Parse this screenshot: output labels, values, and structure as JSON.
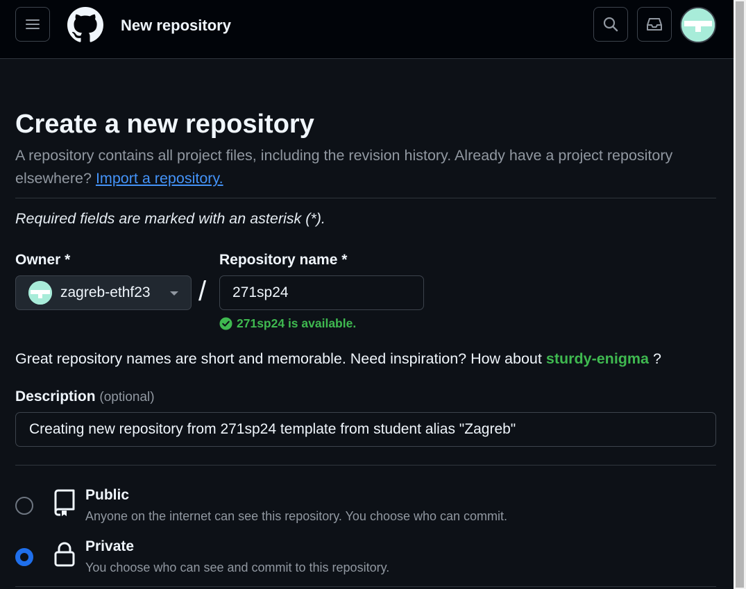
{
  "header": {
    "title": "New repository",
    "icons": {
      "menu": "hamburger-menu-icon",
      "logo": "github-logo-icon",
      "search": "search-icon",
      "inbox": "inbox-icon",
      "avatar": "user-avatar"
    }
  },
  "page": {
    "title": "Create a new repository",
    "intro_text": "A repository contains all project files, including the revision history. Already have a project repository elsewhere?",
    "import_link": "Import a repository.",
    "required_note": "Required fields are marked with an asterisk (*)."
  },
  "owner": {
    "label": "Owner *",
    "value": "zagreb-ethf23"
  },
  "repo_name": {
    "label": "Repository name *",
    "value": "271sp24",
    "availability": "271sp24 is available."
  },
  "suggestion": {
    "text": "Great repository names are short and memorable. Need inspiration? How about",
    "name": "sturdy-enigma",
    "end": "?"
  },
  "description": {
    "label": "Description",
    "optional": "(optional)",
    "value": "Creating new repository from 271sp24 template from student alias \"Zagreb\""
  },
  "visibility": [
    {
      "title": "Public",
      "desc": "Anyone on the internet can see this repository. You choose who can commit.",
      "selected": false,
      "icon": "repo-icon"
    },
    {
      "title": "Private",
      "desc": "You choose who can see and commit to this repository.",
      "selected": true,
      "icon": "lock-icon"
    }
  ],
  "colors": {
    "background": "#0d1117",
    "header_bg": "#010409",
    "success": "#3fb950",
    "link": "#4493f8",
    "radio_selected": "#1f6feb"
  }
}
